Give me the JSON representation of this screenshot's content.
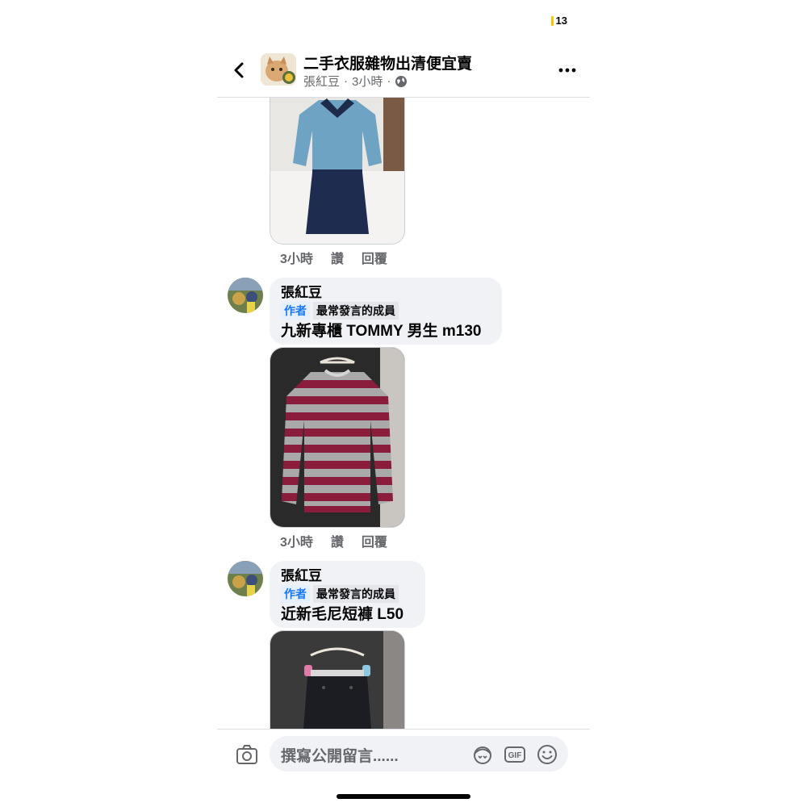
{
  "status": {
    "battery": "13"
  },
  "header": {
    "title": "二手衣服雜物出清便宜賣",
    "author": "張紅豆",
    "time": "3小時",
    "dot": "·"
  },
  "post1": {
    "meta": {
      "time": "3小時",
      "like": "讚",
      "reply": "回覆"
    }
  },
  "comment1": {
    "name": "張紅豆",
    "badge_author": "作者",
    "badge_top": "最常發言的成員",
    "text": "九新專櫃 TOMMY 男生 m130",
    "meta": {
      "time": "3小時",
      "like": "讚",
      "reply": "回覆"
    }
  },
  "comment2": {
    "name": "張紅豆",
    "badge_author": "作者",
    "badge_top": "最常發言的成員",
    "text": "近新毛尼短褲 L50"
  },
  "composer": {
    "placeholder": "撰寫公開留言......"
  },
  "colors": {
    "accent": "#1877f2",
    "bubble": "#f0f2f5",
    "muted": "#65676b"
  }
}
